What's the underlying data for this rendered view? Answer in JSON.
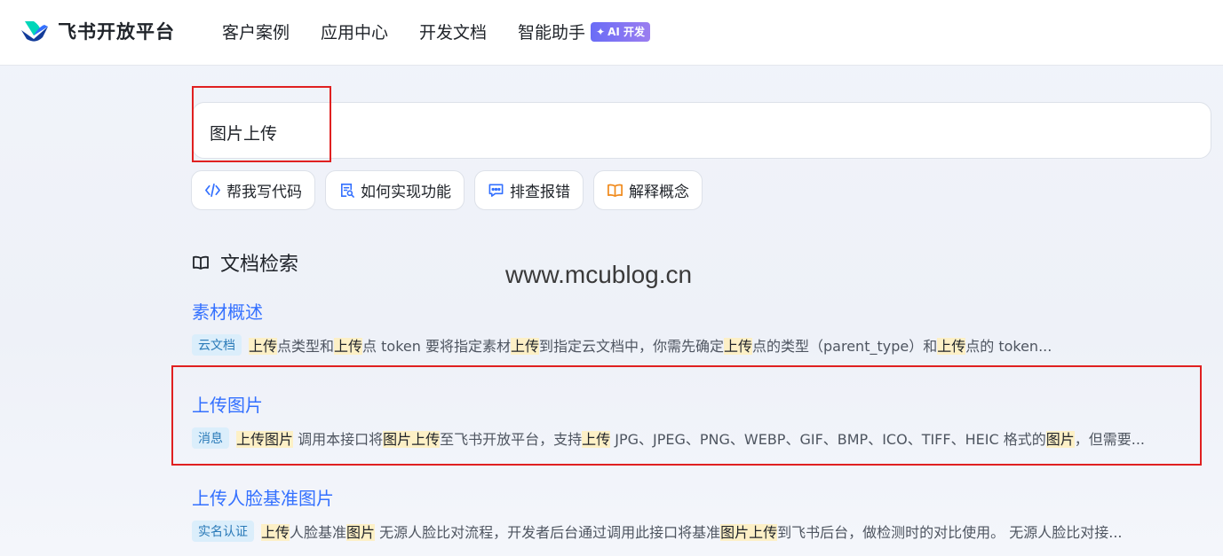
{
  "header": {
    "brand": "飞书开放平台",
    "nav": [
      "客户案例",
      "应用中心",
      "开发文档",
      "智能助手"
    ],
    "ai_badge": "AI 开发"
  },
  "search": {
    "query": "图片上传"
  },
  "chips": [
    {
      "label": "帮我写代码",
      "icon": "code-icon"
    },
    {
      "label": "如何实现功能",
      "icon": "doc-search-icon"
    },
    {
      "label": "排查报错",
      "icon": "chat-dots-icon"
    },
    {
      "label": "解释概念",
      "icon": "book-icon"
    }
  ],
  "section": {
    "title": "文档检索"
  },
  "watermark": "www.mcublog.cn",
  "results": [
    {
      "title": "素材概述",
      "tag": "云文档",
      "snippet": [
        {
          "t": "上传",
          "h": true
        },
        {
          "t": "点类型和",
          "h": false
        },
        {
          "t": "上传",
          "h": true
        },
        {
          "t": "点 token 要将指定素材",
          "h": false
        },
        {
          "t": "上传",
          "h": true
        },
        {
          "t": "到指定云文档中，你需先确定",
          "h": false
        },
        {
          "t": "上传",
          "h": true
        },
        {
          "t": "点的类型（parent_type）和",
          "h": false
        },
        {
          "t": "上传",
          "h": true
        },
        {
          "t": "点的 token...",
          "h": false
        }
      ]
    },
    {
      "title": "上传图片",
      "tag": "消息",
      "snippet": [
        {
          "t": "上传图片",
          "h": true
        },
        {
          "t": " 调用本接口将",
          "h": false
        },
        {
          "t": "图片上传",
          "h": true
        },
        {
          "t": "至飞书开放平台，支持",
          "h": false
        },
        {
          "t": "上传",
          "h": true
        },
        {
          "t": " JPG、JPEG、PNG、WEBP、GIF、BMP、ICO、TIFF、HEIC 格式的",
          "h": false
        },
        {
          "t": "图片",
          "h": true
        },
        {
          "t": "，但需要...",
          "h": false
        }
      ]
    },
    {
      "title": "上传人脸基准图片",
      "tag": "实名认证",
      "snippet": [
        {
          "t": "上传",
          "h": true
        },
        {
          "t": "人脸基准",
          "h": false
        },
        {
          "t": "图片",
          "h": true
        },
        {
          "t": " 无源人脸比对流程，开发者后台通过调用此接口将基准",
          "h": false
        },
        {
          "t": "图片上传",
          "h": true
        },
        {
          "t": "到飞书后台，做检测时的对比使用。 无源人脸比对接...",
          "h": false
        }
      ]
    }
  ],
  "colors": {
    "accent": "#3370ff",
    "highlight": "#fdf0c6",
    "annotation": "#e02020"
  }
}
